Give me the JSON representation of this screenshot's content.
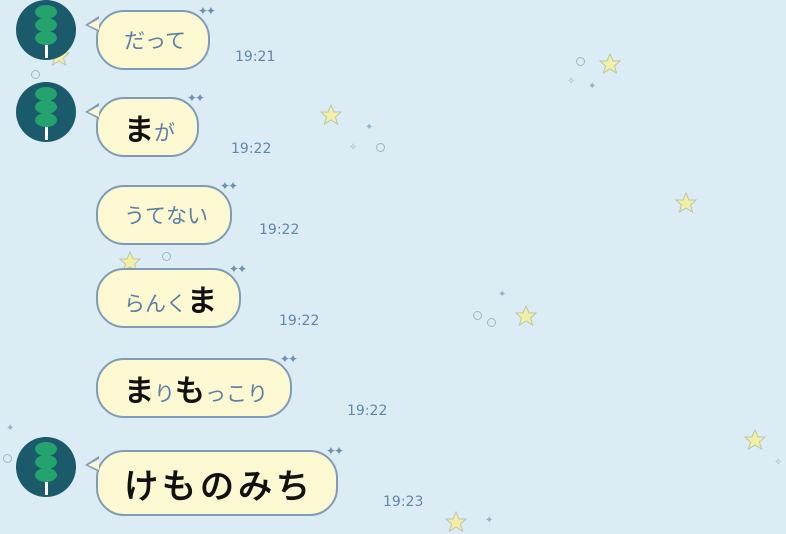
{
  "messages": [
    {
      "segments": [
        {
          "text": "だって",
          "style": "plain"
        }
      ],
      "time": "19:21",
      "avatar": true
    },
    {
      "segments": [
        {
          "text": "ま",
          "style": "big"
        },
        {
          "text": "が",
          "style": "plain"
        }
      ],
      "time": "19:22",
      "avatar": true
    },
    {
      "segments": [
        {
          "text": "うてない",
          "style": "plain"
        }
      ],
      "time": "19:22",
      "avatar": false
    },
    {
      "segments": [
        {
          "text": "らんく",
          "style": "plain"
        },
        {
          "text": "ま",
          "style": "big"
        }
      ],
      "time": "19:22",
      "avatar": false
    },
    {
      "segments": [
        {
          "text": "ま",
          "style": "big"
        },
        {
          "text": "り",
          "style": "plain"
        },
        {
          "text": "も",
          "style": "big"
        },
        {
          "text": "っこり",
          "style": "plain"
        }
      ],
      "time": "19:22",
      "avatar": false
    },
    {
      "segments": [
        {
          "text": "けものみち",
          "style": "huge"
        }
      ],
      "time": "19:23",
      "avatar": true
    }
  ],
  "colors": {
    "background": "#dcecf4",
    "bubble_fill": "#fcf9d2",
    "bubble_border": "#7e9cb6",
    "time_text": "#5e88ae",
    "avatar_bg": "#1a5a6a",
    "avatar_icon": "#25a36f"
  },
  "avatar_icon": "dango-icon"
}
